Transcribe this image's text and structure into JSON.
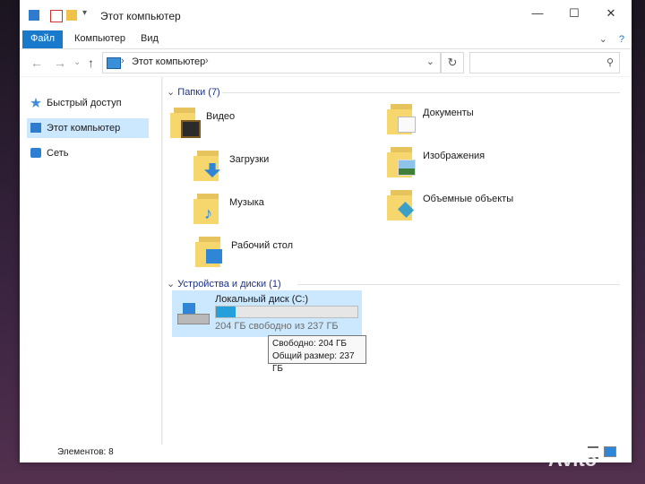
{
  "window": {
    "title": "Этот компьютер",
    "controls": {
      "minimize": "—",
      "maximize": "☐",
      "close": "✕"
    }
  },
  "ribbon": {
    "tabs": [
      "Файл",
      "Компьютер",
      "Вид"
    ],
    "collapse_glyph": "⌄",
    "help_glyph": "?"
  },
  "navigation": {
    "back": "←",
    "forward": "→",
    "recent": "⌄",
    "up": "↑",
    "breadcrumb": "Этот компьютер",
    "chevron": "›",
    "dropdown": "⌄",
    "refresh": "↻",
    "search_placeholder": ""
  },
  "sidebar": {
    "items": [
      {
        "label": "Быстрый доступ",
        "icon": "star-icon",
        "color": "#3d8bd9"
      },
      {
        "label": "Этот компьютер",
        "icon": "computer-icon",
        "color": "#2f7ccf",
        "active": true
      },
      {
        "label": "Сеть",
        "icon": "network-icon",
        "color": "#2c7fd3"
      }
    ]
  },
  "main": {
    "folders_header": "Папки (7)",
    "folders": [
      {
        "label": "Видео",
        "icon": "video-folder-icon"
      },
      {
        "label": "Документы",
        "icon": "documents-folder-icon"
      },
      {
        "label": "Загрузки",
        "icon": "downloads-folder-icon"
      },
      {
        "label": "Изображения",
        "icon": "pictures-folder-icon"
      },
      {
        "label": "Музыка",
        "icon": "music-folder-icon"
      },
      {
        "label": "Объемные объекты",
        "icon": "3d-objects-folder-icon"
      },
      {
        "label": "Рабочий стол",
        "icon": "desktop-folder-icon"
      }
    ],
    "devices_header": "Устройства и диски (1)",
    "drive": {
      "name": "Локальный диск (C:)",
      "free_text": "204 ГБ свободно из 237 ГБ",
      "used_fraction": 0.14,
      "tooltip_free": "Свободно: 204 ГБ",
      "tooltip_total": "Общий размер: 237 ГБ"
    }
  },
  "status": {
    "items": "Элементов: 8"
  },
  "colors": {
    "accent": "#1979ca",
    "selection": "#cce8ff",
    "drive_fill": "#26a0da",
    "folder": "#f5d76e"
  },
  "watermark": "Avito"
}
